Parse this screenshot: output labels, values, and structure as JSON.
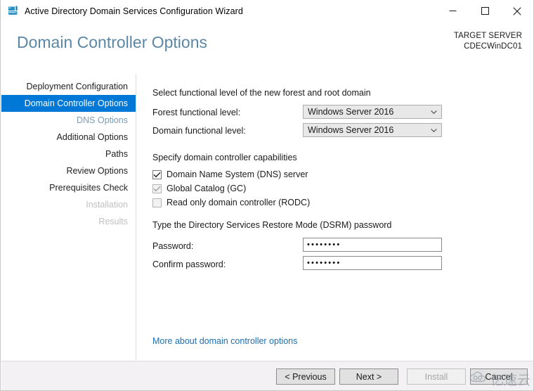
{
  "window": {
    "title": "Active Directory Domain Services Configuration Wizard",
    "icon": "ad-server-icon",
    "controls": {
      "minimize": "minimize-icon",
      "maximize": "maximize-icon",
      "close": "close-icon"
    }
  },
  "header": {
    "page_title": "Domain Controller Options",
    "target_label": "TARGET SERVER",
    "target_server": "CDECWinDC01",
    "accent_color": "#5b87a5"
  },
  "sidebar": {
    "selected_color": "#0078d7",
    "items": [
      {
        "label": "Deployment Configuration",
        "state": "normal"
      },
      {
        "label": "Domain Controller Options",
        "state": "selected"
      },
      {
        "label": "DNS Options",
        "state": "muted"
      },
      {
        "label": "Additional Options",
        "state": "normal"
      },
      {
        "label": "Paths",
        "state": "normal"
      },
      {
        "label": "Review Options",
        "state": "normal"
      },
      {
        "label": "Prerequisites Check",
        "state": "normal"
      },
      {
        "label": "Installation",
        "state": "disabled"
      },
      {
        "label": "Results",
        "state": "disabled"
      }
    ]
  },
  "main": {
    "functional_level": {
      "heading": "Select functional level of the new forest and root domain",
      "forest_label": "Forest functional level:",
      "forest_value": "Windows Server 2016",
      "domain_label": "Domain functional level:",
      "domain_value": "Windows Server 2016"
    },
    "capabilities": {
      "heading": "Specify domain controller capabilities",
      "items": [
        {
          "label": "Domain Name System (DNS) server",
          "checked": true,
          "enabled": true
        },
        {
          "label": "Global Catalog (GC)",
          "checked": true,
          "enabled": false
        },
        {
          "label": "Read only domain controller (RODC)",
          "checked": false,
          "enabled": false
        }
      ]
    },
    "dsrm": {
      "heading": "Type the Directory Services Restore Mode (DSRM) password",
      "password_label": "Password:",
      "password_value": "••••••••",
      "confirm_label": "Confirm password:",
      "confirm_value": "••••••••"
    },
    "more_link": "More about domain controller options"
  },
  "footer": {
    "previous": "< Previous",
    "next": "Next >",
    "install": "Install",
    "cancel": "Cancel"
  },
  "watermark": {
    "text": "亿速云",
    "icon": "cloud-logo-icon"
  }
}
